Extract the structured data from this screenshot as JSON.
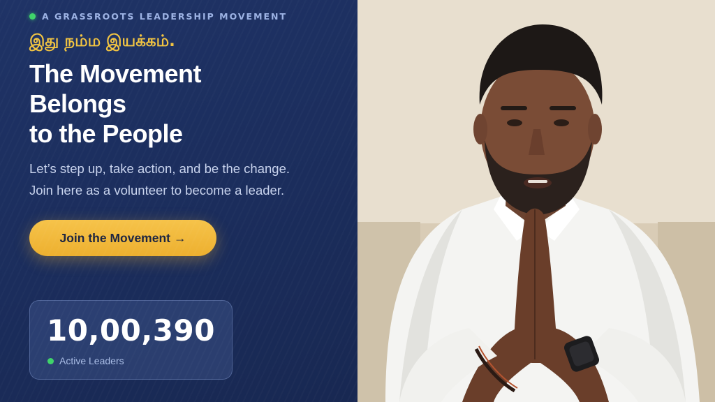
{
  "hero": {
    "eyebrow": "A GRASSROOTS LEADERSHIP MOVEMENT",
    "tamil_tagline": "இது நம்ம இயக்கம்.",
    "headline_lines": [
      "The Movement",
      "Belongs",
      "to the People"
    ],
    "subtext_lines": [
      "Let’s step up, take action, and be the change.",
      "Join here as a volunteer to become a leader."
    ],
    "cta_label": "Join the Movement",
    "cta_arrow": "→"
  },
  "stats": {
    "count": "10,00,390",
    "label": "Active Leaders"
  },
  "colors": {
    "panel_bg": "#1f3366",
    "accent_gold": "#f2c441",
    "button_gold": "#f6c34a",
    "status_green": "#3fd46a"
  },
  "icons": {
    "live_dot": "green-dot-icon",
    "arrow": "arrow-right-icon"
  }
}
